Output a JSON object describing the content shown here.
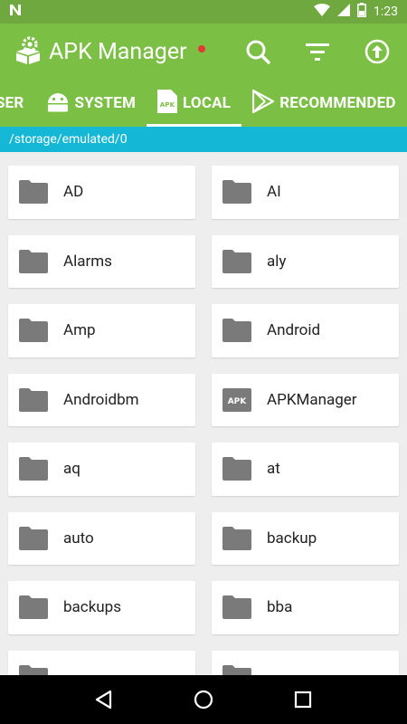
{
  "status": {
    "time": "1:23",
    "left_icon": "n-notification-icon",
    "icons": [
      "wifi-icon",
      "signal-icon",
      "battery-icon"
    ]
  },
  "appbar": {
    "title": "APK Manager",
    "logo_icon": "gear-box-icon",
    "actions": [
      "search-icon",
      "filter-icon",
      "upload-icon"
    ]
  },
  "tabs": [
    {
      "label": "SER",
      "icon": "",
      "active": false
    },
    {
      "label": "SYSTEM",
      "icon": "android-icon",
      "active": false
    },
    {
      "label": "LOCAL",
      "icon": "apk-file-icon",
      "active": true
    },
    {
      "label": "RECOMMENDED",
      "icon": "play-store-icon",
      "active": false
    }
  ],
  "path": "/storage/emulated/0",
  "files": [
    {
      "name": "AD",
      "icon": "folder-icon"
    },
    {
      "name": "AI",
      "icon": "folder-icon"
    },
    {
      "name": "Alarms",
      "icon": "folder-icon"
    },
    {
      "name": "aly",
      "icon": "folder-icon"
    },
    {
      "name": "Amp",
      "icon": "folder-icon"
    },
    {
      "name": "Android",
      "icon": "folder-icon"
    },
    {
      "name": "Androidbm",
      "icon": "folder-icon"
    },
    {
      "name": "APKManager",
      "icon": "apk-icon",
      "icon_text": "APK"
    },
    {
      "name": "aq",
      "icon": "folder-icon"
    },
    {
      "name": "at",
      "icon": "folder-icon"
    },
    {
      "name": "auto",
      "icon": "folder-icon"
    },
    {
      "name": "backup",
      "icon": "folder-icon"
    },
    {
      "name": "backups",
      "icon": "folder-icon"
    },
    {
      "name": "bba",
      "icon": "folder-icon"
    },
    {
      "name": "",
      "icon": "folder-icon"
    },
    {
      "name": "",
      "icon": "folder-icon"
    }
  ],
  "colors": {
    "statusbar": "#6ea83f",
    "appbar": "#7bbf45",
    "pathbar": "#14b7d6",
    "folder": "#7a7a7a"
  }
}
